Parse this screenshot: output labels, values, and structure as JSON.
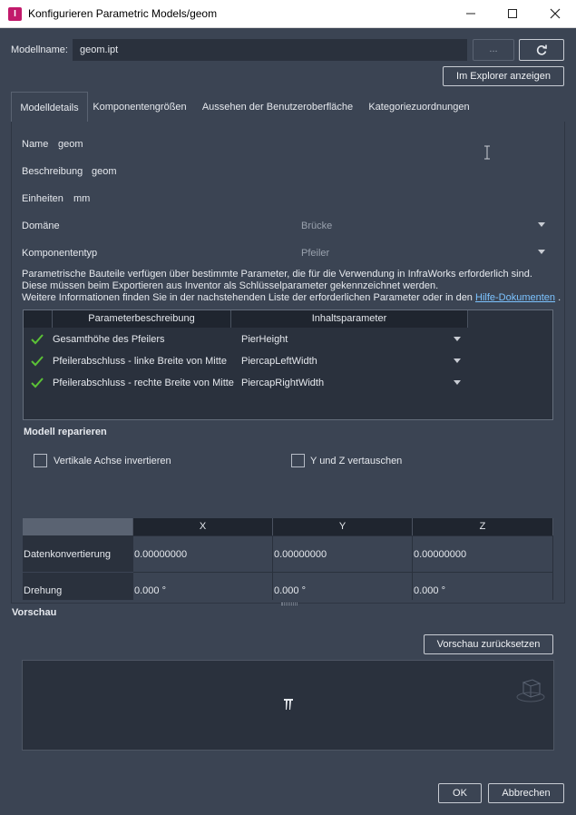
{
  "window": {
    "title": "Konfigurieren Parametric Models/geom",
    "app_icon_letter": "I"
  },
  "model": {
    "label": "Modellname:",
    "value": "geom.ipt",
    "browse_label": "...",
    "show_in_explorer": "Im Explorer anzeigen"
  },
  "tabs": [
    {
      "label": "Modelldetails"
    },
    {
      "label": "Komponentengrößen"
    },
    {
      "label": "Aussehen der Benutzeroberfläche"
    },
    {
      "label": "Kategoriezuordnungen"
    }
  ],
  "details": {
    "name_label": "Name",
    "name_value": "geom",
    "desc_label": "Beschreibung",
    "desc_value": "geom",
    "units_label": "Einheiten",
    "units_value": "mm",
    "domain_label": "Domäne",
    "domain_value": "Brücke",
    "type_label": "Komponententyp",
    "type_value": "Pfeiler"
  },
  "info": {
    "line1": "Parametrische Bauteile verfügen über bestimmte Parameter, die für die Verwendung in InfraWorks erforderlich sind.",
    "line2": "Diese müssen beim Exportieren aus Inventor als Schlüsselparameter gekennzeichnet werden.",
    "line3": "Weitere Informationen finden Sie in der nachstehenden Liste der erforderlichen Parameter oder in den",
    "link": "Hilfe-Dokumenten",
    "line3_end": "."
  },
  "param_table": {
    "headers": [
      "Parameterbeschreibung",
      "Inhaltsparameter"
    ],
    "rows": [
      {
        "description": "Gesamthöhe des Pfeilers",
        "parameter": "PierHeight"
      },
      {
        "description": "Pfeilerabschluss - linke Breite von Mitte",
        "parameter": "PiercapLeftWidth"
      },
      {
        "description": "Pfeilerabschluss - rechte Breite von Mitte",
        "parameter": "PiercapRightWidth"
      }
    ]
  },
  "repair": {
    "title": "Modell reparieren",
    "invert_axis": "Vertikale Achse invertieren",
    "swap_yz": "Y und Z vertauschen"
  },
  "transform_table": {
    "headers": [
      "X",
      "Y",
      "Z"
    ],
    "rows": [
      {
        "label": "Datenkonvertierung",
        "values": [
          "0.00000000",
          "0.00000000",
          "0.00000000"
        ]
      },
      {
        "label": "Drehung",
        "values": [
          "0.000 °",
          "0.000 °",
          "0.000 °"
        ]
      }
    ]
  },
  "preview": {
    "title": "Vorschau",
    "reset": "Vorschau zurücksetzen"
  },
  "footer": {
    "ok": "OK",
    "cancel": "Abbrechen"
  }
}
